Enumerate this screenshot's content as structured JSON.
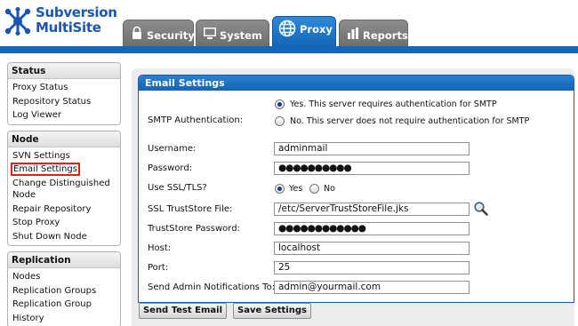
{
  "app": {
    "logo_line1": "Subversion",
    "logo_line2": "MultiSite"
  },
  "tabs": [
    {
      "label": "Security",
      "icon": "lock-icon",
      "active": false
    },
    {
      "label": "System",
      "icon": "monitor-icon",
      "active": false
    },
    {
      "label": "Proxy",
      "icon": "globe-icon",
      "active": true
    },
    {
      "label": "Reports",
      "icon": "bar-chart-icon",
      "active": false
    }
  ],
  "sidebar": {
    "status": {
      "title": "Status",
      "items": [
        "Proxy Status",
        "Repository Status",
        "Log Viewer"
      ]
    },
    "node": {
      "title": "Node",
      "items": [
        "SVN Settings",
        "Email Settings",
        "Change Distinguished Node",
        "Repair Repository",
        "Stop Proxy",
        "Shut Down Node"
      ],
      "selected": "Email Settings"
    },
    "replication": {
      "title": "Replication",
      "items": [
        "Nodes",
        "Replication Groups",
        "Replication Group History"
      ]
    }
  },
  "email": {
    "title": "Email Settings",
    "smtp_auth_label": "SMTP Authentication:",
    "smtp_yes": "Yes. This server requires authentication for SMTP",
    "smtp_no": "No. This server does not require authentication for SMTP",
    "smtp_selected": "yes",
    "username_label": "Username:",
    "username": "adminmail",
    "password_label": "Password:",
    "password": "●●●●●●●●●●",
    "ssl_label": "Use SSL/TLS?",
    "ssl_yes": "Yes",
    "ssl_no": "No",
    "ssl_selected": "yes",
    "truststore_file_label": "SSL TrustStore File:",
    "truststore_file": "/etc/ServerTrustStoreFile.jks",
    "truststore_password_label": "TrustStore Password:",
    "truststore_password": "●●●●●●●●●●●●",
    "host_label": "Host:",
    "host": "localhost",
    "port_label": "Port:",
    "port": "25",
    "notify_label": "Send Admin Notifications To:",
    "notify": "admin@yourmail.com"
  },
  "buttons": {
    "send_test": "Send Test Email",
    "save": "Save Settings"
  },
  "colors": {
    "accent_blue": "#1566b8",
    "selection_outline": "#e0201c",
    "logo_blue": "#1a56b0"
  }
}
